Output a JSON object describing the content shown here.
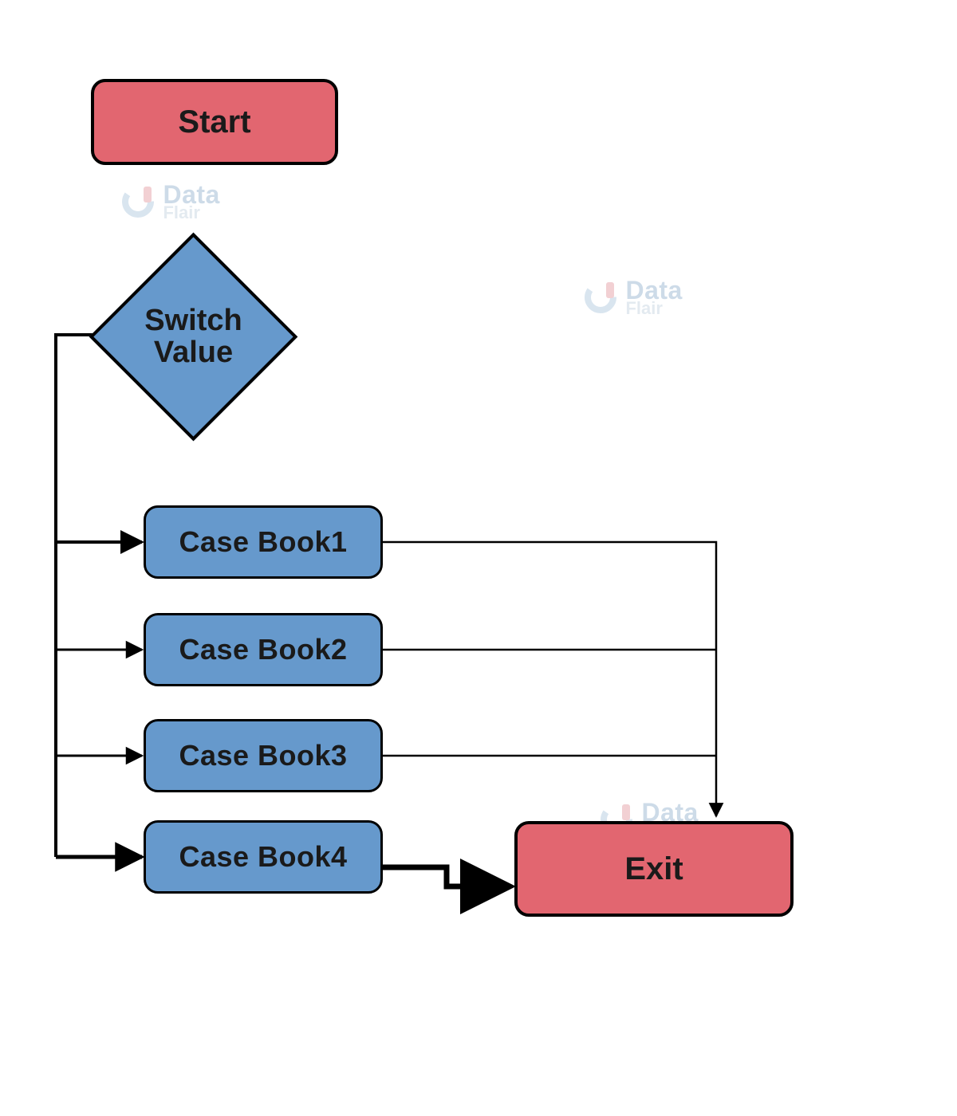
{
  "nodes": {
    "start": {
      "label": "Start"
    },
    "switch": {
      "label": "Switch\nValue"
    },
    "case1": {
      "label": "Case Book1"
    },
    "case2": {
      "label": "Case Book2"
    },
    "case3": {
      "label": "Case Book3"
    },
    "case4": {
      "label": "Case Book4"
    },
    "exit": {
      "label": "Exit"
    }
  },
  "watermark": {
    "brand_top": "Data",
    "brand_bottom": "Flair"
  },
  "edges": [
    {
      "from": "start",
      "to": "switch"
    },
    {
      "from": "switch",
      "to": "case1"
    },
    {
      "from": "switch",
      "to": "case2"
    },
    {
      "from": "switch",
      "to": "case3"
    },
    {
      "from": "switch",
      "to": "case4"
    },
    {
      "from": "case1",
      "to": "exit"
    },
    {
      "from": "case2",
      "to": "exit"
    },
    {
      "from": "case3",
      "to": "exit"
    },
    {
      "from": "case4",
      "to": "exit"
    }
  ],
  "colors": {
    "terminal_fill": "#e26670",
    "process_fill": "#6699cc",
    "stroke": "#000000"
  }
}
